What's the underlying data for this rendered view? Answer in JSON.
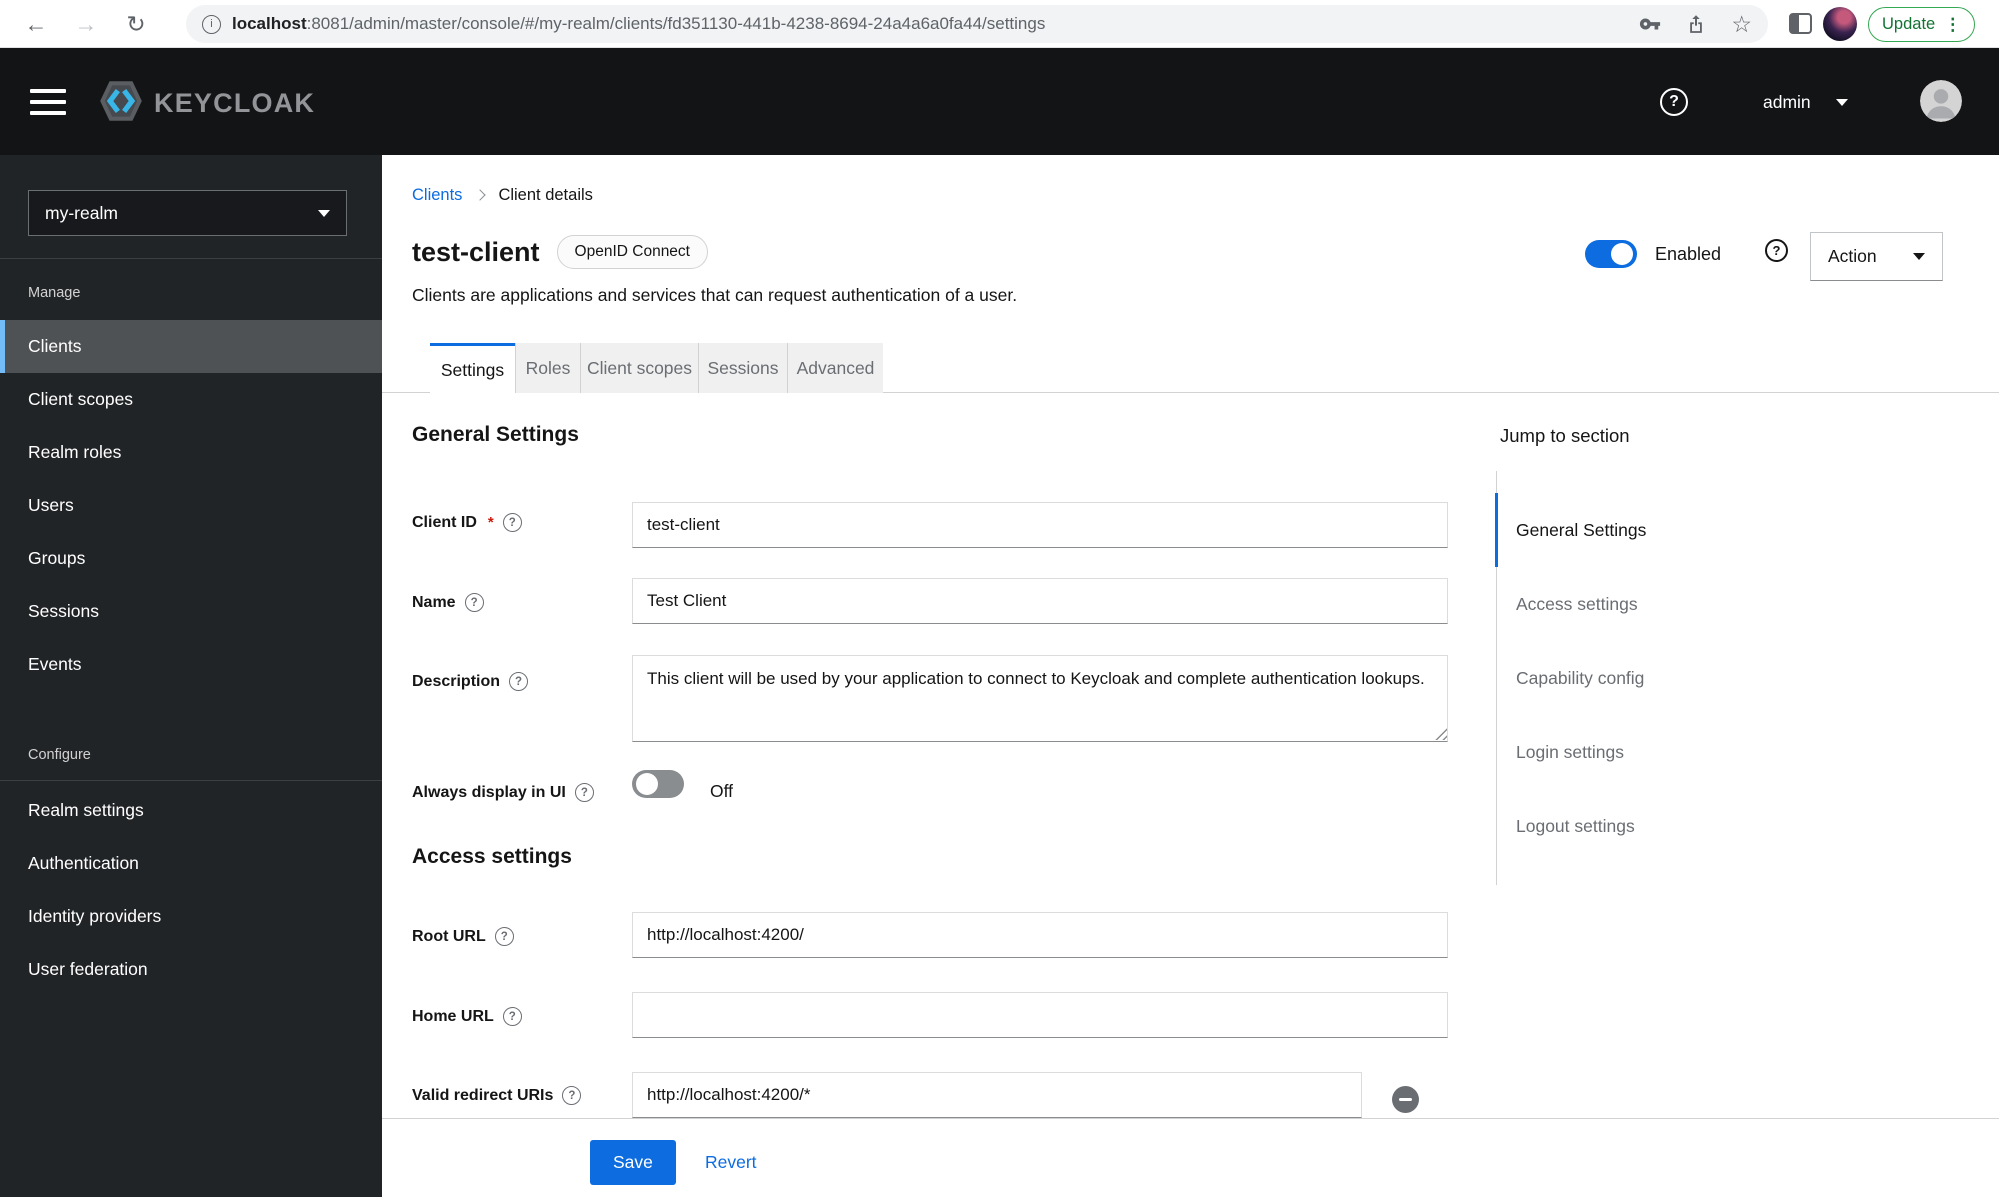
{
  "browser": {
    "url_host": "localhost",
    "url_rest": ":8081/admin/master/console/#/my-realm/clients/fd351130-441b-4238-8694-24a4a6a0fa44/settings",
    "update_label": "Update"
  },
  "icons": {
    "back": "←",
    "forward": "→",
    "reload": "↻",
    "info": "i",
    "star": "☆",
    "dots": "⋮",
    "help": "?"
  },
  "header": {
    "brand": "KEYCLOAK",
    "username": "admin"
  },
  "sidebar": {
    "realm": "my-realm",
    "sections": [
      {
        "label": "Manage",
        "items": [
          "Clients",
          "Client scopes",
          "Realm roles",
          "Users",
          "Groups",
          "Sessions",
          "Events"
        ]
      },
      {
        "label": "Configure",
        "items": [
          "Realm settings",
          "Authentication",
          "Identity providers",
          "User federation"
        ]
      }
    ],
    "active_item": "Clients"
  },
  "page": {
    "breadcrumb": [
      "Clients",
      "Client details"
    ],
    "title": "test-client",
    "protocol_badge": "OpenID Connect",
    "subtitle": "Clients are applications and services that can request authentication of a user.",
    "enabled_label": "Enabled",
    "action_label": "Action",
    "tabs": [
      "Settings",
      "Roles",
      "Client scopes",
      "Sessions",
      "Advanced"
    ],
    "active_tab": "Settings"
  },
  "form": {
    "general_heading": "General Settings",
    "access_heading": "Access settings",
    "client_id": {
      "label": "Client ID",
      "required_marker": "*",
      "value": "test-client"
    },
    "name": {
      "label": "Name",
      "value": "Test Client"
    },
    "description": {
      "label": "Description",
      "value": "This client will be used by your application to connect to Keycloak and complete authentication lookups."
    },
    "always_display": {
      "label": "Always display in UI",
      "state": "Off"
    },
    "root_url": {
      "label": "Root URL",
      "value": "http://localhost:4200/"
    },
    "home_url": {
      "label": "Home URL",
      "value": ""
    },
    "valid_redirect_uris": {
      "label": "Valid redirect URIs",
      "value": "http://localhost:4200/*"
    }
  },
  "jump_nav": {
    "heading": "Jump to section",
    "items": [
      "General Settings",
      "Access settings",
      "Capability config",
      "Login settings",
      "Logout settings"
    ],
    "active": "General Settings"
  },
  "footer": {
    "save": "Save",
    "revert": "Revert"
  },
  "colors": {
    "accent": "#0c6ce0",
    "sidebar_active_bar": "#73bcf7",
    "update_green": "#137333",
    "masthead": "#131416",
    "sidebar_bg": "#212427"
  }
}
